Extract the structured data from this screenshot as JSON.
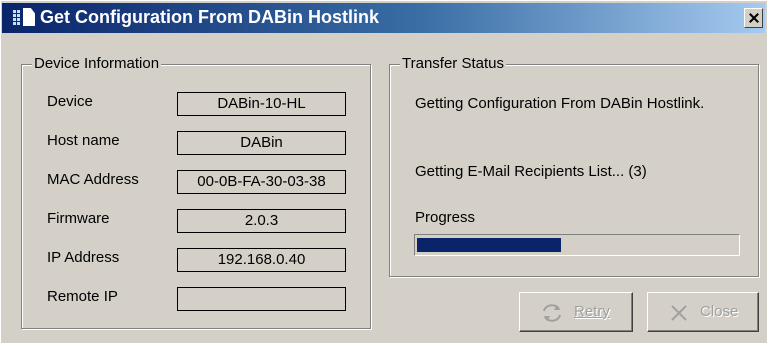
{
  "window": {
    "title": "Get Configuration From DABin Hostlink"
  },
  "device_info": {
    "group_label": "Device Information",
    "fields": [
      {
        "label": "Device",
        "value": "DABin-10-HL"
      },
      {
        "label": "Host name",
        "value": "DABin"
      },
      {
        "label": "MAC Address",
        "value": "00-0B-FA-30-03-38"
      },
      {
        "label": "Firmware",
        "value": "2.0.3"
      },
      {
        "label": "IP Address",
        "value": "192.168.0.40"
      },
      {
        "label": "Remote IP",
        "value": ""
      }
    ]
  },
  "transfer_status": {
    "group_label": "Transfer Status",
    "status_line": "Getting Configuration From DABin Hostlink.",
    "detail_line": "Getting E-Mail Recipients List... (3)",
    "progress_label": "Progress",
    "progress_fraction": 0.45
  },
  "buttons": {
    "retry": {
      "label": "Retry",
      "icon": "retry-icon",
      "enabled": false
    },
    "close": {
      "label": "Close",
      "icon": "close-x-icon",
      "enabled": false
    }
  },
  "colors": {
    "titlebar_start": "#0a246a",
    "titlebar_end": "#a6caf0",
    "progress_fill": "#0a246a",
    "dialog_bg": "#d4d0c8"
  }
}
